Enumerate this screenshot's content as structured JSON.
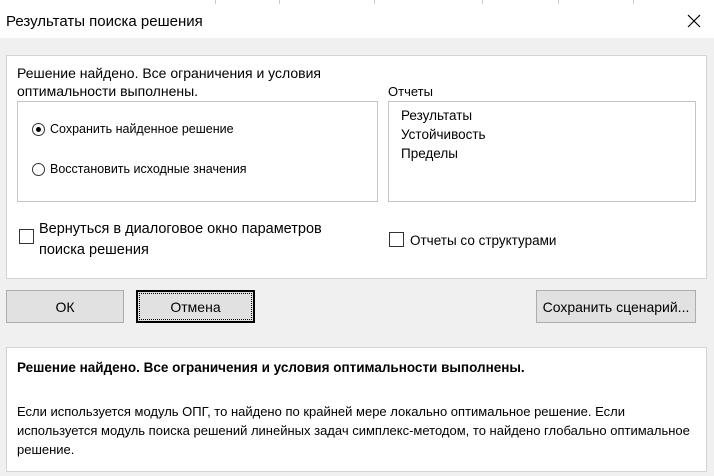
{
  "window": {
    "title": "Результаты поиска решения"
  },
  "status": {
    "message": "Решение найдено. Все ограничения и условия оптимальности выполнены."
  },
  "options": {
    "keep_solution_label": "Сохранить найденное решение",
    "keep_solution_checked": true,
    "restore_values_label": "Восстановить исходные значения",
    "restore_values_checked": false
  },
  "reports": {
    "label": "Отчеты",
    "items": [
      "Результаты",
      "Устойчивость",
      "Пределы"
    ]
  },
  "checkboxes": {
    "return_to_params_label": "Вернуться в диалоговое окно параметров поиска решения",
    "return_to_params_checked": false,
    "outline_reports_label": "Отчеты со структурами",
    "outline_reports_checked": false
  },
  "buttons": {
    "ok_label": "ОК",
    "cancel_label": "Отмена",
    "save_scenario_label": "Сохранить сценарий..."
  },
  "details": {
    "headline": "Решение найдено. Все ограничения и условия оптимальности выполнены.",
    "description": "Если используется модуль ОПГ, то найдено по крайней мере локально оптимальное решение. Если используется модуль поиска решений линейных задач симплекс-методом, то найдено глобально оптимальное решение."
  }
}
